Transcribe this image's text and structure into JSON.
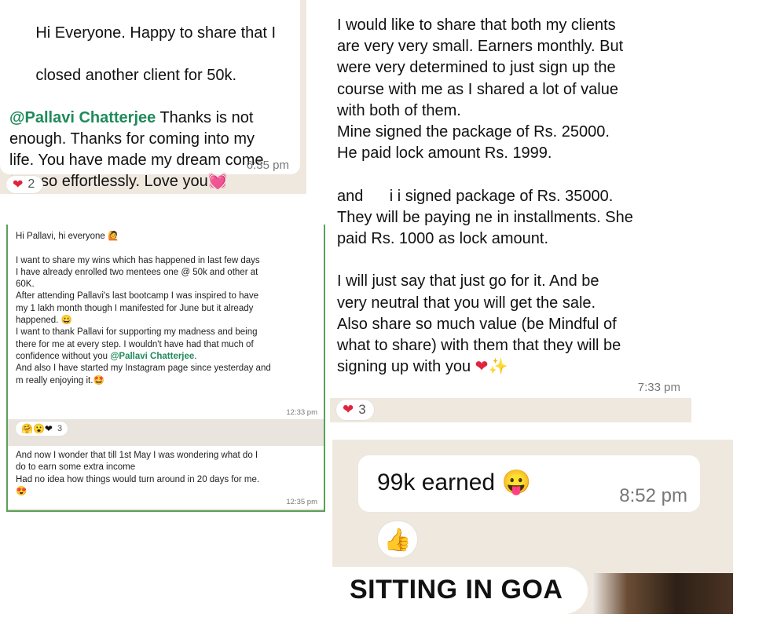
{
  "s1": {
    "line1": "Hi Everyone. Happy to share that I",
    "line2": "closed another client for 50k.",
    "mention": "@Pallavi Chatterjee",
    "body_rest": " Thanks is not\nenough. Thanks for coming into my\nlife. You have made my dream come\ntrue so effortlessly. Love you",
    "emoji": "💓",
    "time": "6:35 pm",
    "reaction_emoji": "❤",
    "reaction_count": "2"
  },
  "s2": {
    "text_pre": "I would like to share that both my clients\nare very very small. Earners monthly. But\nwere very determined to just sign up the\ncourse with me as I shared a lot of value\nwith both of them.\nMine signed the package of Rs. 25000.\nHe paid lock amount Rs. 1999.\n\nand      i i signed package of Rs. 35000.\nThey will be paying ne in installments. She\npaid Rs. 1000 as lock amount.\n\nI will just say that just go for it. And be\nvery neutral that you will get the sale.\nAlso share so much value (be Mindful of\nwhat to share) with them that they will be\nsigning up with you ",
    "emoji_heart": "❤",
    "emoji_sparkles": "✨",
    "time": "7:33 pm",
    "reaction_emoji": "❤",
    "reaction_count": "3"
  },
  "s3": {
    "greeting": "Hi Pallavi, hi everyone ",
    "greeting_emoji": "🙋",
    "text_pre": "I want to share my wins which has happened in last few days\nI have already enrolled two mentees one @ 50k and other at\n60K.\nAfter attending Pallavi's last bootcamp I was inspired to have\nmy 1 lakh month though I manifested for June but it already\nhappened. ",
    "emoji_smile": "😀",
    "text_mid": "\nI want to thank Pallavi for supporting my madness and being\nthere for me at every step. I wouldn't have had that much of\nconfidence without you ",
    "mention": "@Pallavi Chatterjee",
    "text_post": ".\nAnd also I have started my Instagram page since yesterday and\nm really enjoying it.",
    "emoji_end": "🤩",
    "time1": "12:33 pm",
    "reactions": "🤗😮❤",
    "reaction_count": "3",
    "text2": "And now I wonder that till 1st May I was wondering what do I\ndo to earn some extra income\nHad no idea how things would turn around in 20 days for me.",
    "emoji2": "😍",
    "time2": "12:35 pm"
  },
  "s4": {
    "text": "99k earned ",
    "emoji": "😛",
    "time": "8:52 pm",
    "reaction": "👍",
    "caption": "SITTING IN GOA"
  }
}
